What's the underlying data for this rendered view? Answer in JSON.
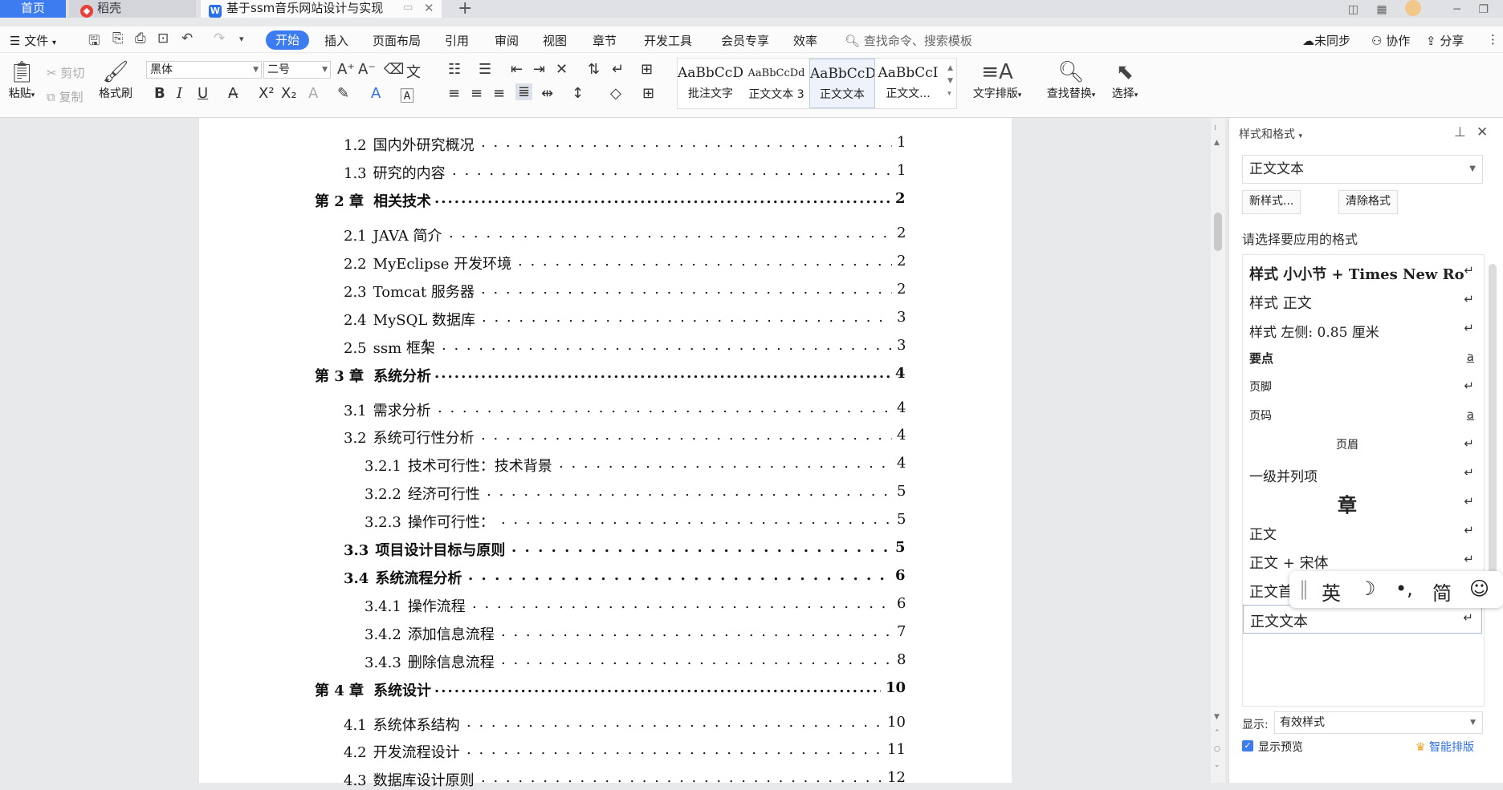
{
  "tabs": {
    "home": "首页",
    "daoke": "稻壳",
    "doc_title": "基于ssm音乐网站设计与实现"
  },
  "menu": {
    "file": "文件",
    "items": [
      "开始",
      "插入",
      "页面布局",
      "引用",
      "审阅",
      "视图",
      "章节",
      "开发工具",
      "会员专享",
      "效率"
    ],
    "search_placeholder": "查找命令、搜索模板",
    "sync": "未同步",
    "collab": "协作",
    "share": "分享"
  },
  "ribbon": {
    "paste": "粘贴",
    "cut": "剪切",
    "copy": "复制",
    "format_painter": "格式刷",
    "font_name": "黑体",
    "font_size": "二号",
    "style_gallery": [
      {
        "preview": "AaBbCcDc",
        "name": "批注文字"
      },
      {
        "preview": "AaBbCcDd",
        "name": "正文文本 3"
      },
      {
        "preview": "AaBbCcDc",
        "name": "正文文本"
      },
      {
        "preview": "AaBbCcI",
        "name": "正文文..."
      }
    ],
    "text_layout": "文字排版",
    "find_replace": "查找替换",
    "select": "选择"
  },
  "toc": [
    {
      "num": "1.2",
      "title": "国内外研究概况",
      "page": "1",
      "level": 2
    },
    {
      "num": "1.3",
      "title": "研究的内容",
      "page": "1",
      "level": 2
    },
    {
      "num": "第 2 章",
      "title": "相关技术",
      "page": "2",
      "level": 1
    },
    {
      "num": "2.1",
      "title": "JAVA 简介",
      "page": "2",
      "level": 2
    },
    {
      "num": "2.2",
      "title": "MyEclipse 开发环境",
      "page": "2",
      "level": 2
    },
    {
      "num": "2.3",
      "title": "Tomcat 服务器",
      "page": "2",
      "level": 2
    },
    {
      "num": "2.4",
      "title": "MySQL 数据库",
      "page": "3",
      "level": 2
    },
    {
      "num": "2.5",
      "title": "ssm 框架",
      "page": "3",
      "level": 2
    },
    {
      "num": "第 3 章",
      "title": "系统分析",
      "page": "4",
      "level": 1
    },
    {
      "num": "3.1",
      "title": "需求分析",
      "page": "4",
      "level": 2
    },
    {
      "num": "3.2",
      "title": "系统可行性分析",
      "page": "4",
      "level": 2
    },
    {
      "num": "3.2.1",
      "title": "技术可行性：技术背景",
      "page": "4",
      "level": 3
    },
    {
      "num": "3.2.2",
      "title": "经济可行性",
      "page": "5",
      "level": 3
    },
    {
      "num": "3.2.3",
      "title": "操作可行性：",
      "page": "5",
      "level": 3
    },
    {
      "num": "3.3",
      "title": "项目设计目标与原则",
      "page": "5",
      "level": 2,
      "bold": true
    },
    {
      "num": "3.4",
      "title": "系统流程分析",
      "page": "6",
      "level": 2,
      "bold": true
    },
    {
      "num": "3.4.1",
      "title": "操作流程",
      "page": "6",
      "level": 3
    },
    {
      "num": "3.4.2",
      "title": "添加信息流程",
      "page": "7",
      "level": 3
    },
    {
      "num": "3.4.3",
      "title": "删除信息流程",
      "page": "8",
      "level": 3
    },
    {
      "num": "第 4 章",
      "title": "系统设计",
      "page": "10",
      "level": 1
    },
    {
      "num": "4.1",
      "title": "系统体系结构",
      "page": "10",
      "level": 2
    },
    {
      "num": "4.2",
      "title": "开发流程设计",
      "page": "11",
      "level": 2
    },
    {
      "num": "4.3",
      "title": "数据库设计原则",
      "page": "12",
      "level": 2
    }
  ],
  "panel": {
    "title": "样式和格式",
    "current_style": "正文文本",
    "new_style": "新样式...",
    "clear_format": "清除格式",
    "hint": "请选择要应用的格式",
    "styles": [
      {
        "label": "样式  小小节 + Times New Ro",
        "mark": "↵"
      },
      {
        "label": "样式  正文",
        "mark": "↵"
      },
      {
        "label": "样式  左侧:   0.85  厘米",
        "mark": "↵"
      },
      {
        "label": "要点",
        "mark": "a"
      },
      {
        "label": "页脚",
        "mark": "↵"
      },
      {
        "label": "页码",
        "mark": "a"
      },
      {
        "label": "页眉",
        "mark": "↵"
      },
      {
        "label": "一级并列项",
        "mark": "↵"
      },
      {
        "label": "章",
        "mark": "↵"
      },
      {
        "label": "正文",
        "mark": "↵"
      },
      {
        "label": "正文 + 宋体",
        "mark": "↵"
      },
      {
        "label": "正文首行缩进",
        "mark": "↵"
      },
      {
        "label": "正文文本",
        "mark": "↵"
      }
    ],
    "show_label": "显示:",
    "show_value": "有效样式",
    "show_preview": "显示预览",
    "smart_layout": "智能排版"
  },
  "ime": {
    "english": "英",
    "simplified": "简"
  }
}
